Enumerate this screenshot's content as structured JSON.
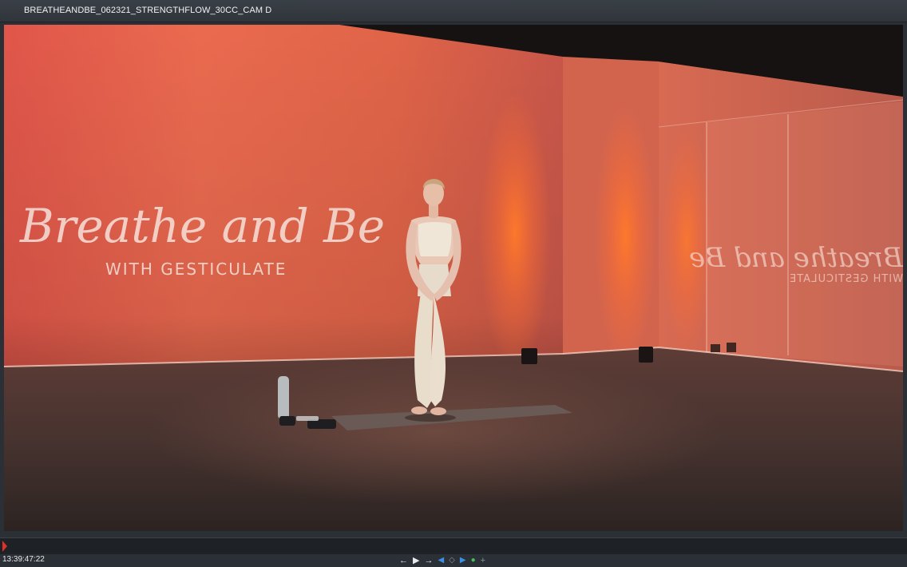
{
  "window": {
    "title": "BREATHEANDBE_062321_STRENGTHFLOW_30CC_CAM D"
  },
  "video": {
    "wall_script": "Breathe and Be",
    "wall_subtitle": "WITH GESTICULATE",
    "mirror_script": "Breathe and Be",
    "mirror_subtitle": "WITH GESTICULATE"
  },
  "timeline": {
    "playhead_position": 0.0
  },
  "transport": {
    "timecode": "13:39:47:22",
    "buttons": [
      {
        "name": "prev-frame-button",
        "glyph": "←",
        "icon": "arrow-left-icon"
      },
      {
        "name": "play-button",
        "glyph": "▶",
        "icon": "play-icon"
      },
      {
        "name": "next-frame-button",
        "glyph": "→",
        "icon": "arrow-right-icon"
      },
      {
        "name": "mark-in-button",
        "glyph": "◀",
        "icon": "mark-in-icon"
      },
      {
        "name": "mark-diamond-button",
        "glyph": "◇",
        "icon": "diamond-icon"
      },
      {
        "name": "mark-out-button",
        "glyph": "▶",
        "icon": "mark-out-icon"
      },
      {
        "name": "marker-button",
        "glyph": "●",
        "icon": "green-marker-icon"
      },
      {
        "name": "add-button",
        "glyph": "+",
        "icon": "plus-icon"
      }
    ]
  },
  "colors": {
    "wall": "#e4684e",
    "floor": "#4a3633",
    "chrome": "#2b3036",
    "playhead": "#e0302a"
  }
}
